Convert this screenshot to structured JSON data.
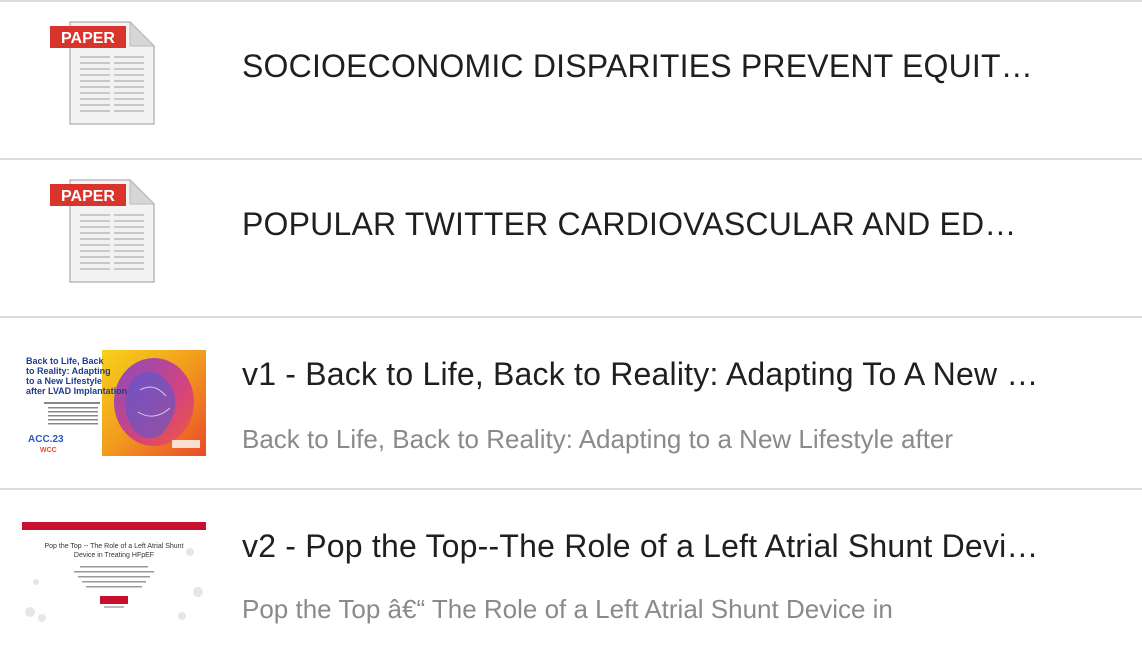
{
  "items": [
    {
      "type": "paper",
      "icon_label": "PAPER",
      "title": "SOCIOECONOMIC DISPARITIES PREVENT EQUIT…"
    },
    {
      "type": "paper",
      "icon_label": "PAPER",
      "title": "POPULAR TWITTER CARDIOVASCULAR AND ED…"
    },
    {
      "type": "slides",
      "title": "v1 - Back to Life, Back to Reality: Adapting To A New …",
      "subtitle": "Back to Life, Back to Reality: Adapting to a New Lifestyle after",
      "thumb": {
        "heading": "Back to Life, Back to Reality: Adapting to a New Lifestyle after LVAD Implantation",
        "badge": "ACC.23"
      }
    },
    {
      "type": "slides",
      "title": "v2 - Pop the Top--The Role of a Left Atrial Shunt Devi…",
      "subtitle": "Pop the Top â€“ The Role of a Left Atrial Shunt Device in",
      "thumb": {
        "heading": "Pop the Top -- The Role of a Left Atrial Shunt Device in Treating HFpEF"
      }
    }
  ],
  "colors": {
    "paper_banner": "#d9342b",
    "divider": "#dcdcdc",
    "title": "#1f1f1f",
    "subtitle": "#8a8a8a"
  }
}
